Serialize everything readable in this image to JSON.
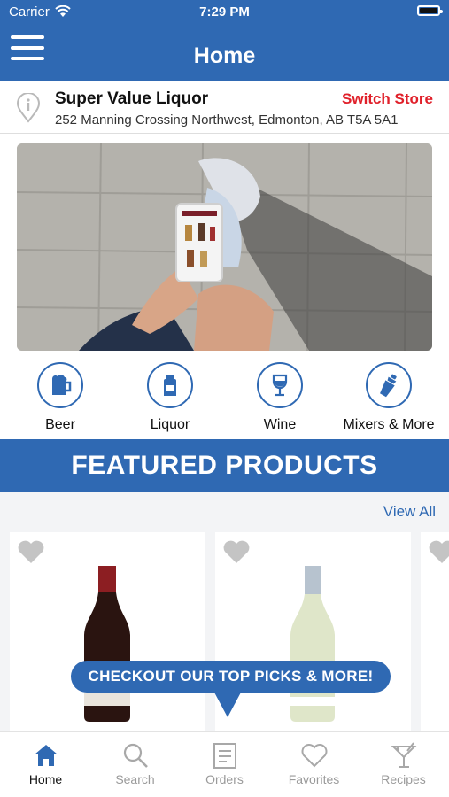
{
  "status": {
    "carrier": "Carrier",
    "time": "7:29 PM"
  },
  "nav": {
    "title": "Home"
  },
  "store": {
    "name": "Super Value Liquor",
    "address": "252 Manning Crossing Northwest, Edmonton, AB T5A 5A1",
    "switch_label": "Switch Store"
  },
  "categories": [
    {
      "label": "Beer",
      "icon": "beer-mug-icon"
    },
    {
      "label": "Liquor",
      "icon": "liquor-bottle-icon"
    },
    {
      "label": "Wine",
      "icon": "wine-glass-icon"
    },
    {
      "label": "Mixers & More",
      "icon": "shaker-icon"
    }
  ],
  "featured": {
    "title": "FEATURED PRODUCTS",
    "view_all": "View All"
  },
  "bubble": {
    "text": "CHECKOUT OUR TOP PICKS & MORE!"
  },
  "tabs": [
    {
      "label": "Home",
      "icon": "home-icon",
      "active": true
    },
    {
      "label": "Search",
      "icon": "search-icon",
      "active": false
    },
    {
      "label": "Orders",
      "icon": "orders-icon",
      "active": false
    },
    {
      "label": "Favorites",
      "icon": "heart-icon",
      "active": false
    },
    {
      "label": "Recipes",
      "icon": "cocktail-icon",
      "active": false
    }
  ],
  "colors": {
    "brand": "#2f69b3",
    "accent": "#e0202a"
  }
}
